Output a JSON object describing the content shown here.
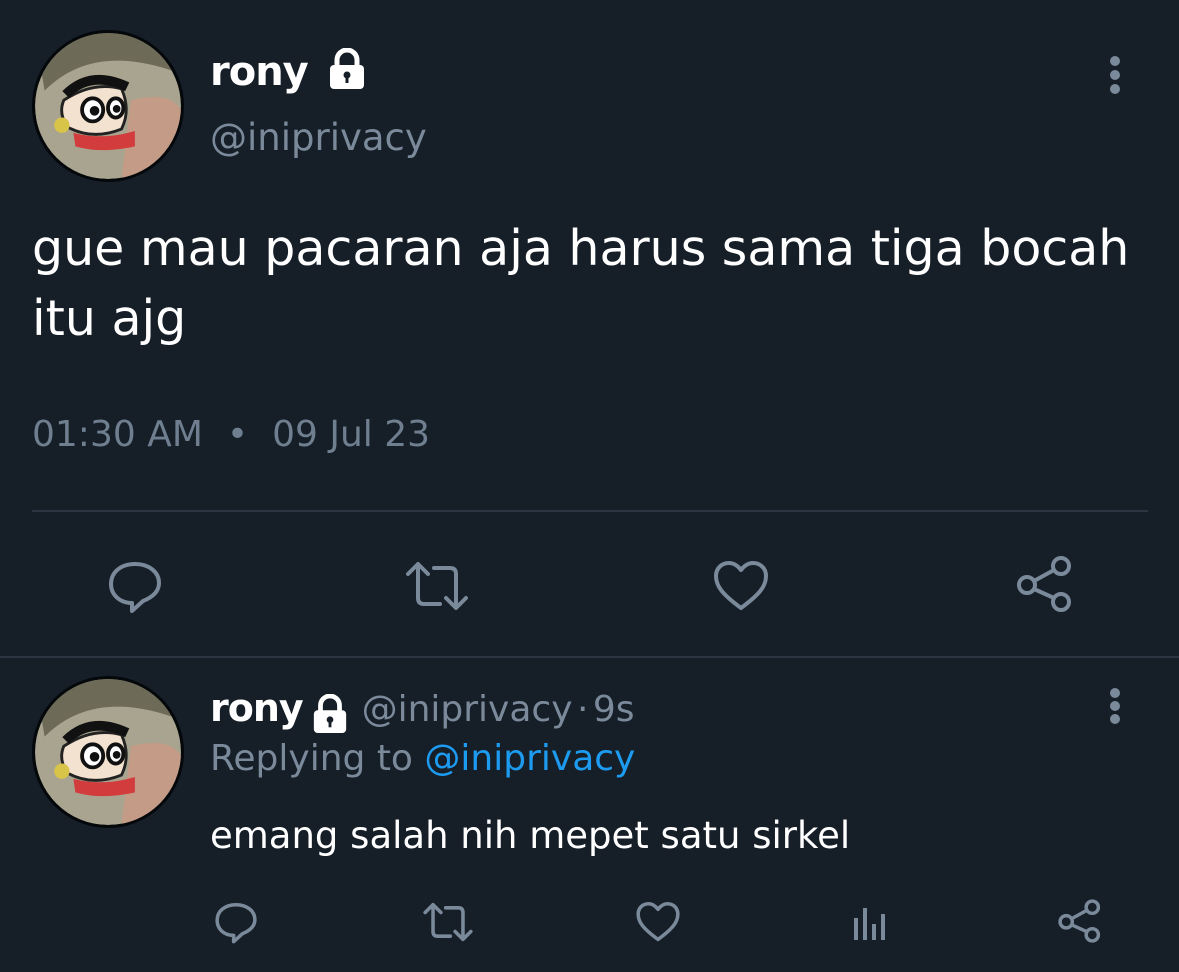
{
  "main_tweet": {
    "author_name": "rony",
    "handle": "@iniprivacy",
    "text": "gue mau pacaran aja harus sama tiga bocah itu ajg",
    "time": "01:30 AM",
    "separator": "•",
    "date": "09 Jul 23"
  },
  "reply": {
    "author_name": "rony",
    "handle": "@iniprivacy",
    "dot": "·",
    "age": "9s",
    "replying_prefix": "Replying to",
    "replying_to": "@iniprivacy",
    "text": "emang salah nih mepet satu sirkel"
  },
  "icons": {
    "lock": "lock-icon",
    "more": "more-vertical-icon",
    "reply": "comment-icon",
    "retweet": "retweet-icon",
    "like": "heart-icon",
    "share": "share-icon",
    "analytics": "analytics-icon"
  },
  "colors": {
    "background": "#161e28",
    "secondary_text": "#7b8a9a",
    "mention": "#1d9bf0",
    "divider": "#2b3642"
  }
}
